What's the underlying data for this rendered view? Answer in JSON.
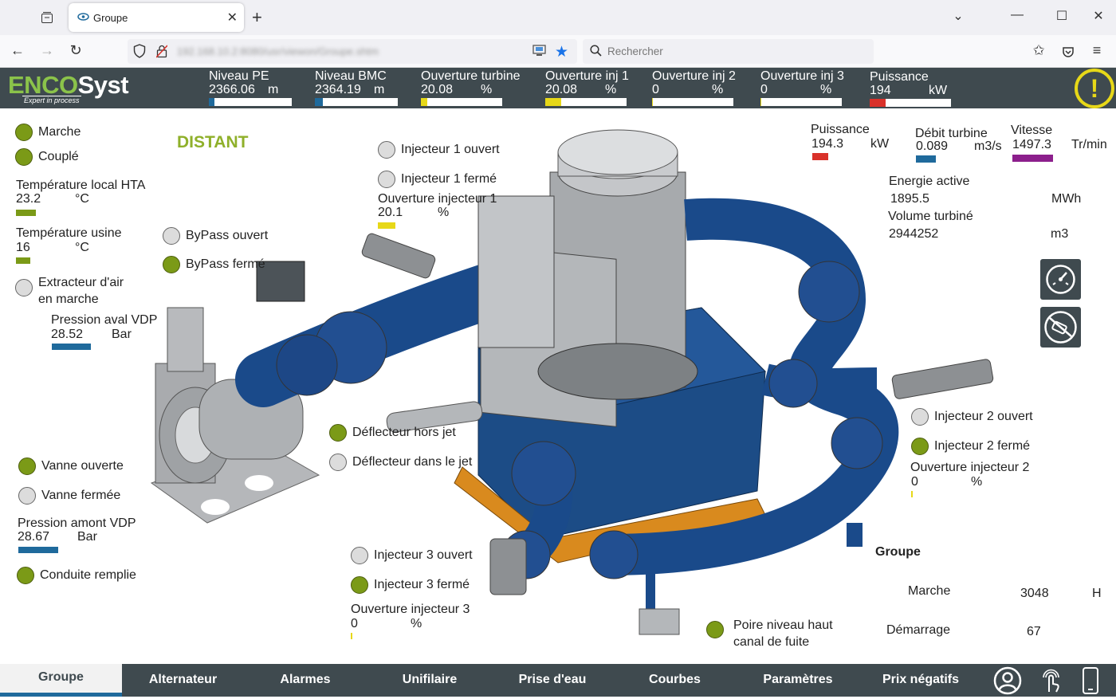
{
  "browser": {
    "tab_title": "Groupe",
    "url": "192.168.10.2:8080/usr/viewon/Groupe.shtm",
    "search_placeholder": "Rechercher"
  },
  "header": {
    "logo_enco": "ENCO",
    "logo_syst": "Syst",
    "logo_tagline": "Expert in process",
    "metrics": [
      {
        "label": "Niveau PE",
        "value": "2366.06",
        "unit": "m",
        "fill": 0.07,
        "color": "#1f6a9c"
      },
      {
        "label": "Niveau BMC",
        "value": "2364.19",
        "unit": "m",
        "fill": 0.1,
        "color": "#1f6a9c"
      },
      {
        "label": "Ouverture turbine",
        "value": "20.08",
        "unit": "%",
        "fill": 0.08,
        "color": "#e7d818"
      },
      {
        "label": "Ouverture inj 1",
        "value": "20.08",
        "unit": "%",
        "fill": 0.2,
        "color": "#e7d818"
      },
      {
        "label": "Ouverture inj 2",
        "value": "0",
        "unit": "%",
        "fill": 0.01,
        "color": "#e7d818"
      },
      {
        "label": "Ouverture inj 3",
        "value": "0",
        "unit": "%",
        "fill": 0.01,
        "color": "#e7d818"
      },
      {
        "label": "Puissance",
        "value": "194",
        "unit": "kW",
        "fill": 0.2,
        "color": "#d9312a"
      }
    ],
    "alert_symbol": "!"
  },
  "left": {
    "marche": "Marche",
    "couple": "Couplé",
    "distant": "DISTANT",
    "temp_hta_label": "Température local HTA",
    "temp_hta_value": "23.2",
    "temp_hta_unit": "°C",
    "temp_usine_label": "Température usine",
    "temp_usine_value": "16",
    "temp_usine_unit": "°C",
    "extracteur_l1": "Extracteur d'air",
    "extracteur_l2": "en marche",
    "bypass_ouvert": "ByPass ouvert",
    "bypass_ferme": "ByPass fermé",
    "pression_aval_label": "Pression aval VDP",
    "pression_aval_value": "28.52",
    "pression_aval_unit": "Bar",
    "vanne_ouverte": "Vanne ouverte",
    "vanne_fermee": "Vanne fermée",
    "pression_amont_label": "Pression amont VDP",
    "pression_amont_value": "28.67",
    "pression_amont_unit": "Bar",
    "conduite_remplie": "Conduite remplie"
  },
  "center": {
    "inj1_ouvert": "Injecteur 1 ouvert",
    "inj1_ferme": "Injecteur 1 fermé",
    "inj1_ouv_label": "Ouverture injecteur 1",
    "inj1_ouv_value": "20.1",
    "inj1_ouv_unit": "%",
    "deflecteur_hors": "Déflecteur hors jet",
    "deflecteur_dans": "Déflecteur dans le jet",
    "inj3_ouvert": "Injecteur 3 ouvert",
    "inj3_ferme": "Injecteur 3 fermé",
    "inj3_ouv_label": "Ouverture injecteur 3",
    "inj3_ouv_value": "0",
    "inj3_ouv_unit": "%",
    "poire_l1": "Poire niveau haut",
    "poire_l2": "canal de fuite"
  },
  "right": {
    "puissance_label": "Puissance",
    "puissance_value": "194.3",
    "puissance_unit": "kW",
    "debit_label": "Débit turbine",
    "debit_value": "0.089",
    "debit_unit": "m3/s",
    "vitesse_label": "Vitesse",
    "vitesse_value": "1497.3",
    "vitesse_unit": "Tr/min",
    "energie_label": "Energie active",
    "energie_value": "1895.5",
    "energie_unit": "MWh",
    "volume_label": "Volume turbiné",
    "volume_value": "2944252",
    "volume_unit": "m3",
    "inj2_ouvert": "Injecteur 2 ouvert",
    "inj2_ferme": "Injecteur 2 fermé",
    "inj2_ouv_label": "Ouverture injecteur 2",
    "inj2_ouv_value": "0",
    "inj2_ouv_unit": "%",
    "groupe_title": "Groupe",
    "marche_label": "Marche",
    "marche_value": "3048",
    "marche_unit": "H",
    "demarrage_label": "Démarrage",
    "demarrage_value": "67"
  },
  "bottom_nav": [
    "Groupe",
    "Alternateur",
    "Alarmes",
    "Unifilaire",
    "Prise d'eau",
    "Courbes",
    "Paramètres",
    "Prix négatifs"
  ]
}
